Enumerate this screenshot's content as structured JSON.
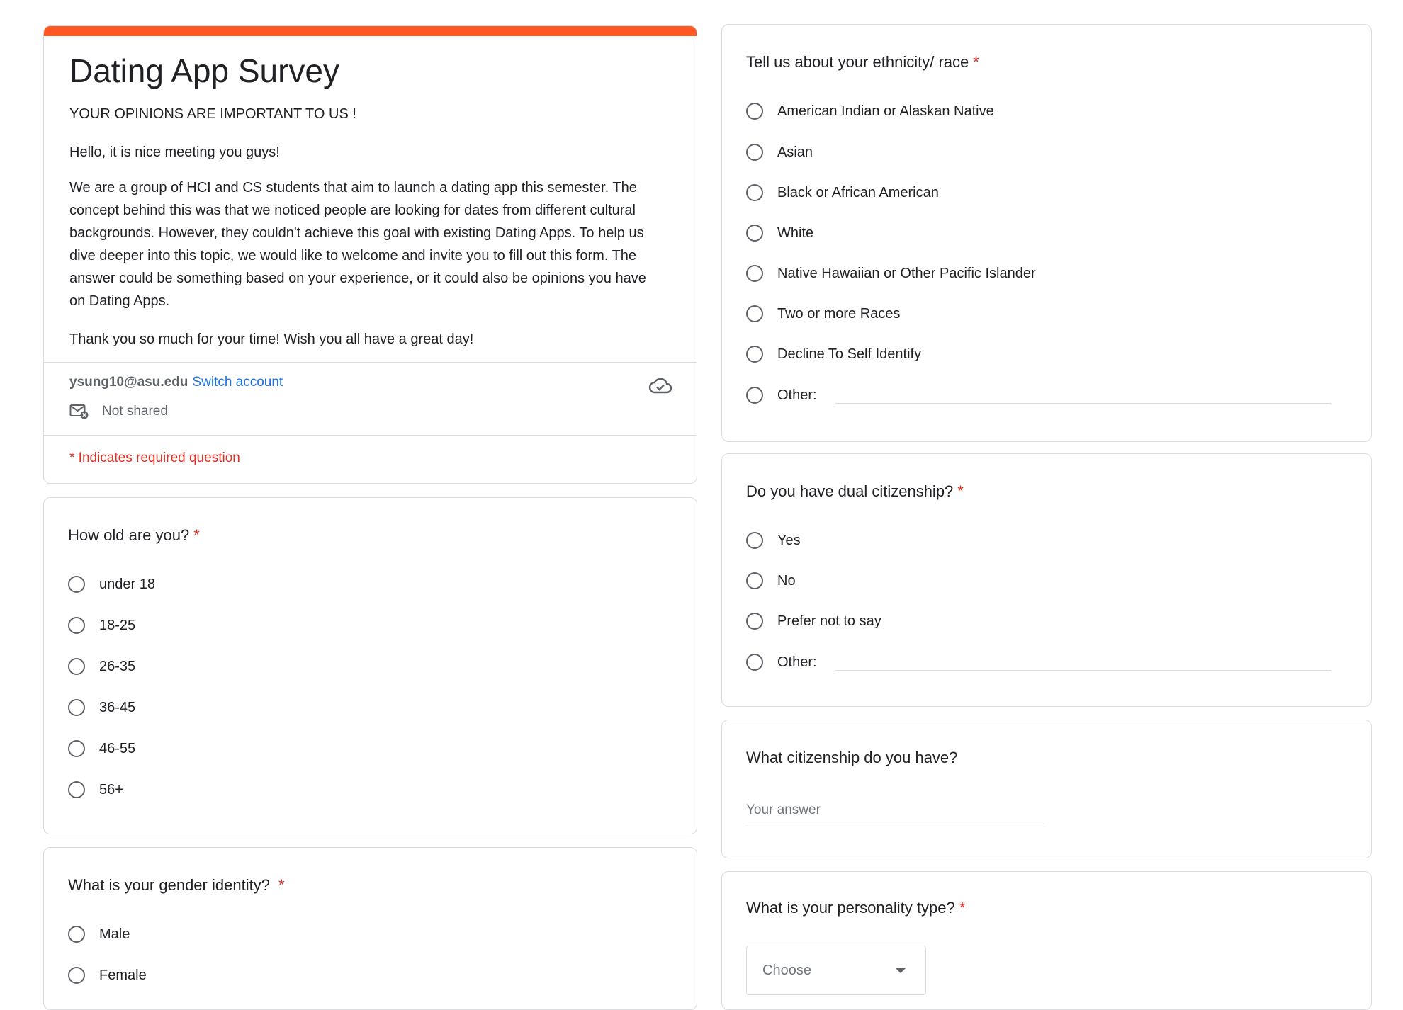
{
  "header": {
    "title": "Dating App Survey",
    "subtitle": "YOUR OPINIONS ARE IMPORTANT TO US !",
    "greeting": "Hello, it is nice meeting you guys!",
    "description": "We are a group of HCI and CS students that aim to launch a dating app this semester. The concept behind this was that we noticed people are looking for dates from different cultural backgrounds. However, they couldn't achieve this goal with existing Dating Apps. To help us dive deeper into this topic, we would like to welcome and invite you to fill out this form. The answer could be something based on your experience, or it could also be opinions you have on Dating Apps.",
    "thanks": "Thank you so much for your time! Wish you all have a great day!",
    "email": "ysung10@asu.edu",
    "switch_account": "Switch account",
    "not_shared": "Not shared",
    "required_note": "* Indicates required question"
  },
  "questions": {
    "age": {
      "title": "How old are you?",
      "required": "*",
      "options": [
        "under 18",
        "18-25",
        "26-35",
        "36-45",
        "46-55",
        "56+"
      ]
    },
    "gender": {
      "title": "What is your gender identity?",
      "required": "*",
      "options": [
        "Male",
        "Female"
      ]
    },
    "ethnicity": {
      "title": "Tell us about your ethnicity/ race",
      "required": "*",
      "options": [
        "American Indian or Alaskan Native",
        "Asian",
        "Black or African American",
        "White",
        "Native Hawaiian or Other Pacific Islander",
        "Two or more Races",
        "Decline To Self Identify"
      ],
      "other_label": "Other:"
    },
    "dual_citizenship": {
      "title": "Do you have dual citizenship?",
      "required": "*",
      "options": [
        "Yes",
        "No",
        "Prefer not to say"
      ],
      "other_label": "Other:"
    },
    "citizenship": {
      "title": "What citizenship do you have?",
      "placeholder": "Your answer"
    },
    "personality": {
      "title": "What is your personality type?",
      "required": "*",
      "select_value": "Choose"
    }
  },
  "colors": {
    "accent": "#ff5722",
    "required": "#d93025",
    "link": "#1a73e8"
  }
}
